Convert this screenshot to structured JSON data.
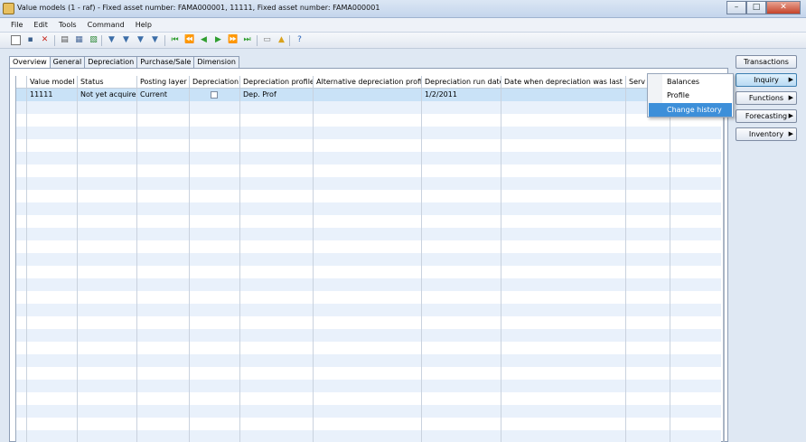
{
  "window": {
    "title": "Value models (1 - raf) - Fixed asset number: FAMA000001, 11111, Fixed asset number: FAMA000001",
    "minimize_glyph": "–",
    "maximize_glyph": "□",
    "close_glyph": "✕"
  },
  "menu": [
    "File",
    "Edit",
    "Tools",
    "Command",
    "Help"
  ],
  "toolbar_icons": [
    {
      "name": "new-icon",
      "glyph": "▫",
      "color": "#ffffff"
    },
    {
      "name": "save-icon",
      "glyph": "▪",
      "color": "#3a5e8c"
    },
    {
      "name": "delete-icon",
      "glyph": "✕",
      "color": "#c8281e"
    },
    {
      "name": "print-icon",
      "glyph": "▤",
      "color": "#555555"
    },
    {
      "name": "print-preview-icon",
      "glyph": "▦",
      "color": "#4a6a9a"
    },
    {
      "name": "export-icon",
      "glyph": "▧",
      "color": "#2f8a3a"
    },
    {
      "name": "filter-icon",
      "glyph": "▼",
      "color": "#3c6ea8"
    },
    {
      "name": "filter-selection-icon",
      "glyph": "▼",
      "color": "#3c6ea8"
    },
    {
      "name": "advanced-filter-icon",
      "glyph": "▼",
      "color": "#3c6ea8"
    },
    {
      "name": "remove-filter-icon",
      "glyph": "▼",
      "color": "#3c6ea8"
    },
    {
      "name": "first-record-icon",
      "glyph": "⏮",
      "color": "#2f9e2f"
    },
    {
      "name": "previous-page-icon",
      "glyph": "⏪",
      "color": "#2f9e2f"
    },
    {
      "name": "previous-record-icon",
      "glyph": "◀",
      "color": "#2f9e2f"
    },
    {
      "name": "next-record-icon",
      "glyph": "▶",
      "color": "#2f9e2f"
    },
    {
      "name": "next-page-icon",
      "glyph": "⏩",
      "color": "#2f9e2f"
    },
    {
      "name": "last-record-icon",
      "glyph": "⏭",
      "color": "#2f9e2f"
    },
    {
      "name": "document-handling-icon",
      "glyph": "▭",
      "color": "#7a7a7a"
    },
    {
      "name": "alert-icon",
      "glyph": "▲",
      "color": "#d9a21c"
    },
    {
      "name": "help-icon",
      "glyph": "?",
      "color": "#2a62b8"
    }
  ],
  "tabs": [
    "Overview",
    "General",
    "Depreciation",
    "Purchase/Sale",
    "Dimension"
  ],
  "active_tab": "Overview",
  "grid": {
    "columns": [
      "Value model",
      "Status",
      "Posting layer",
      "Depreciation",
      "Depreciation profile",
      "Alternative depreciation profile",
      "Depreciation run date",
      "Date when depreciation was last run",
      "Serv"
    ],
    "rows": [
      {
        "value_model": "11111",
        "status": "Not yet acquired",
        "posting_layer": "Current",
        "depreciation_checked": false,
        "depreciation_profile": "Dep. Prof",
        "alt_depreciation_profile": "",
        "depreciation_run_date": "1/2/2011",
        "last_run_date": "",
        "serv": ""
      }
    ]
  },
  "right_buttons": [
    {
      "label": "Transactions",
      "has_submenu": false
    },
    {
      "label": "Inquiry",
      "has_submenu": true
    },
    {
      "label": "Functions",
      "has_submenu": true
    },
    {
      "label": "Forecasting",
      "has_submenu": true
    },
    {
      "label": "Inventory",
      "has_submenu": true
    }
  ],
  "inquiry_menu": [
    "Balances",
    "Profile",
    "Change history"
  ],
  "inquiry_menu_highlighted": "Change history",
  "submenu_glyph": "▶"
}
